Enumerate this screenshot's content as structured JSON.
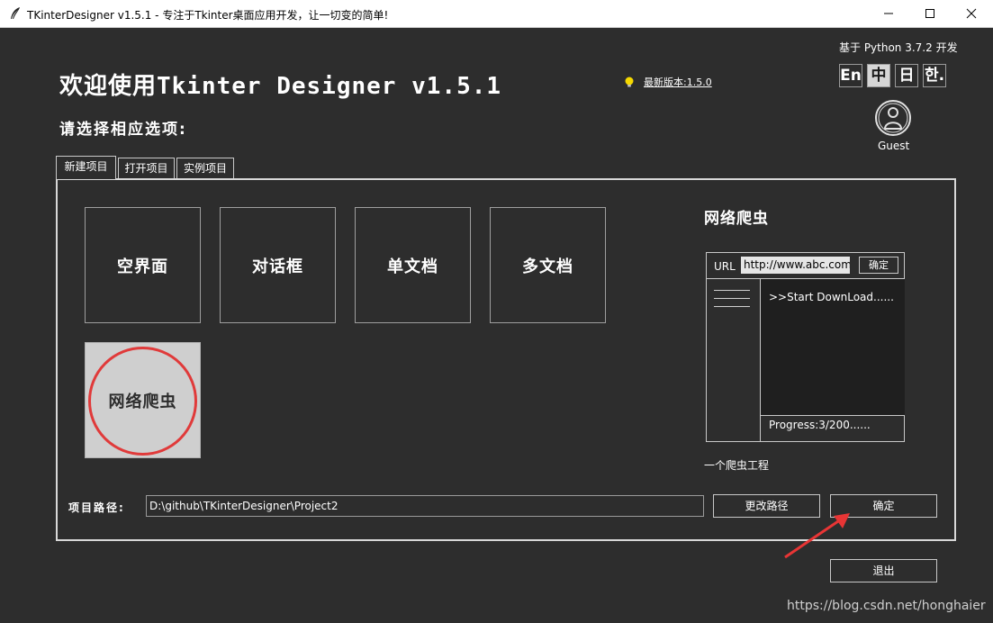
{
  "window": {
    "title": "TKinterDesigner v1.5.1 - 专注于Tkinter桌面应用开发，让一切变的简单!",
    "icon": "feather-icon"
  },
  "header": {
    "python_info": "基于 Python 3.7.2 开发",
    "headline": "欢迎使用Tkinter Designer v1.5.1",
    "subhead": "请选择相应选项:",
    "latest_version_link": "最新版本:1.5.0"
  },
  "languages": [
    "En",
    "中",
    "日",
    "한."
  ],
  "active_language": "中",
  "user": {
    "name": "Guest"
  },
  "tabs": [
    "新建项目",
    "打开项目",
    "实例项目"
  ],
  "active_tab": "新建项目",
  "templates": [
    "空界面",
    "对话框",
    "单文档",
    "多文档",
    "网络爬虫"
  ],
  "selected_template": "网络爬虫",
  "preview": {
    "title": "网络爬虫",
    "url_label": "URL",
    "url_value": "http://www.abc.com",
    "url_button": "确定",
    "log_text": ">>Start DownLoad......",
    "progress_text": "Progress:3/200......",
    "description": "一个爬虫工程"
  },
  "project_path": {
    "label": "项目路径:",
    "value": "D:\\github\\TKinterDesigner\\Project2",
    "change_button": "更改路径",
    "ok_button": "确定"
  },
  "exit_button": "退出",
  "watermark": "https://blog.csdn.net/honghaier",
  "colors": {
    "background": "#2d2d2d",
    "highlight_ring": "#e03a3a",
    "selected_tile": "#cfcfcf",
    "bulb": "#f5d800"
  }
}
